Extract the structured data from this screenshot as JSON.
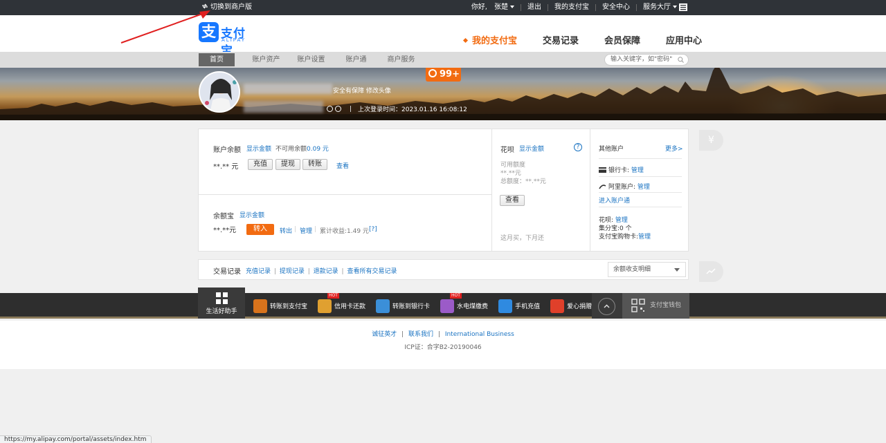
{
  "topbar": {
    "switch_merchant": "切换到商户版",
    "greeting": "你好,",
    "username": "张楚",
    "logout": "退出",
    "my_alipay": "我的支付宝",
    "security": "安全中心",
    "service_hall": "服务大厅"
  },
  "header": {
    "logo_cn": "支付宝",
    "logo_en": "ALIPAY",
    "logo_char": "支",
    "nav": [
      {
        "label": "我的支付宝"
      },
      {
        "label": "交易记录"
      },
      {
        "label": "会员保障"
      },
      {
        "label": "应用中心"
      }
    ]
  },
  "subnav": {
    "tabs": [
      {
        "label": "首页"
      },
      {
        "label": "账户资产"
      },
      {
        "label": "账户设置"
      },
      {
        "label": "账户通"
      },
      {
        "label": "商户服务"
      }
    ],
    "search_placeholder": "输入关键字，如\"密码\""
  },
  "banner": {
    "badge": "99+",
    "secure_text": "安全有保障 修改头像",
    "last_login": "上次登录时间：2023.01.16 16:08:12"
  },
  "account": {
    "balance_label": "账户余额",
    "show_amount": "显示金额",
    "unavailable_label": "不可用余额",
    "unavailable_value": "0.09 元",
    "balance_masked": "**.** 元",
    "recharge": "充值",
    "withdraw": "提现",
    "transfer": "转账",
    "view": "查看"
  },
  "yuebao": {
    "label": "余额宝",
    "show_amount": "显示金额",
    "masked": "**.**元",
    "transfer_in": "转入",
    "transfer_out": "转出",
    "manage": "管理",
    "income_label": "累计收益:",
    "income_value": "1.49 元",
    "help": "[?]"
  },
  "huabei": {
    "label": "花呗",
    "show_amount": "显示金额",
    "help_icon": "?",
    "available_label": "可用额度",
    "available_value": "**.**元",
    "total_label": "总额度：**.**元",
    "view": "查看",
    "slogan": "这月买，下月还"
  },
  "other": {
    "label": "其他账户",
    "more": "更多>",
    "bank_card": "银行卡:",
    "bank_manage": "管理",
    "ali_account": "阿里账户:",
    "ali_manage": "管理",
    "enter": "进入账户通",
    "huabei": "花呗:",
    "huabei_manage": "管理",
    "jifen": "集分宝:0 个",
    "shopcard": "支付宝购物卡:",
    "shopcard_manage": "管理"
  },
  "trade": {
    "label": "交易记录",
    "links": [
      "充值记录",
      "提现记录",
      "退款记录",
      "查看所有交易记录"
    ],
    "select": "余额收支明细"
  },
  "side": {
    "yen": "¥"
  },
  "toolbar": {
    "helper": "生活好助手",
    "tools": [
      {
        "label": "转账到支付宝",
        "icon": "transfer-icon",
        "color": "#d8731c",
        "hot": ""
      },
      {
        "label": "信用卡还款",
        "icon": "credit-card-icon",
        "color": "#e0a030",
        "hot": "HOT"
      },
      {
        "label": "转账到银行卡",
        "icon": "bank-card-icon",
        "color": "#3b8fd8",
        "hot": ""
      },
      {
        "label": "水电煤缴费",
        "icon": "utility-icon",
        "color": "#9b5bc8",
        "hot": "HOT"
      },
      {
        "label": "手机充值",
        "icon": "phone-icon",
        "color": "#2f8ae0",
        "hot": ""
      },
      {
        "label": "爱心捐赠",
        "icon": "heart-icon",
        "color": "#e0402a",
        "hot": ""
      }
    ],
    "wallet": "支付宝钱包"
  },
  "footer": {
    "links": [
      "诚征英才",
      "联系我们",
      "International Business"
    ],
    "icp": "ICP证：合字B2-20190046"
  },
  "status_url": "https://my.alipay.com/portal/assets/index.htm",
  "colors": {
    "accent": "#f26b11",
    "brand": "#1677ff",
    "link": "#1a73c2"
  }
}
